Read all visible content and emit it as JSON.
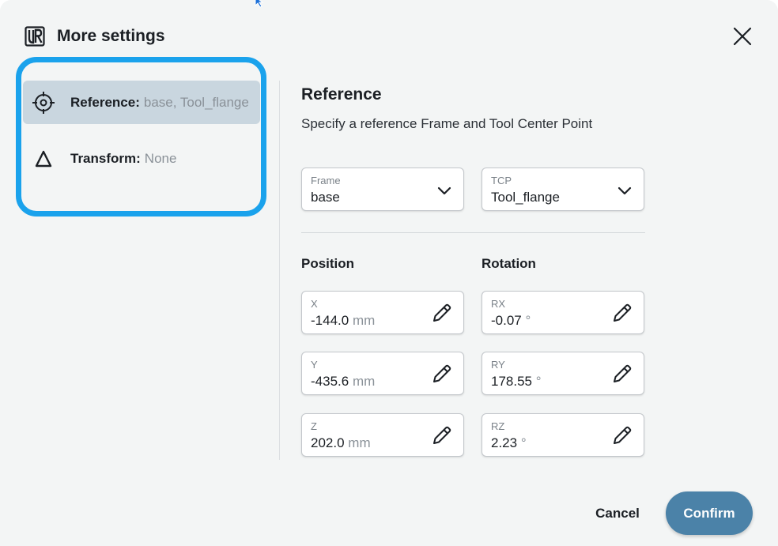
{
  "header": {
    "title": "More settings"
  },
  "sidebar": {
    "items": [
      {
        "label": "Reference:",
        "value": "base, Tool_flange",
        "icon": "crosshair-icon",
        "active": true
      },
      {
        "label": "Transform:",
        "value": "None",
        "icon": "triangle-icon",
        "active": false
      }
    ]
  },
  "reference": {
    "title": "Reference",
    "subtitle": "Specify a reference Frame and Tool Center Point",
    "frame": {
      "label": "Frame",
      "value": "base"
    },
    "tcp": {
      "label": "TCP",
      "value": "Tool_flange"
    }
  },
  "position": {
    "title": "Position",
    "x": {
      "label": "X",
      "value": "-144.0",
      "unit": "mm"
    },
    "y": {
      "label": "Y",
      "value": "-435.6",
      "unit": "mm"
    },
    "z": {
      "label": "Z",
      "value": "202.0",
      "unit": "mm"
    }
  },
  "rotation": {
    "title": "Rotation",
    "rx": {
      "label": "RX",
      "value": "-0.07",
      "unit": "°"
    },
    "ry": {
      "label": "RY",
      "value": "178.55",
      "unit": "°"
    },
    "rz": {
      "label": "RZ",
      "value": "2.23",
      "unit": "°"
    }
  },
  "footer": {
    "cancel_label": "Cancel",
    "confirm_label": "Confirm"
  },
  "colors": {
    "accent": "#4b82a8",
    "highlight": "#1aa2ec",
    "active_item": "#c9d6df"
  }
}
